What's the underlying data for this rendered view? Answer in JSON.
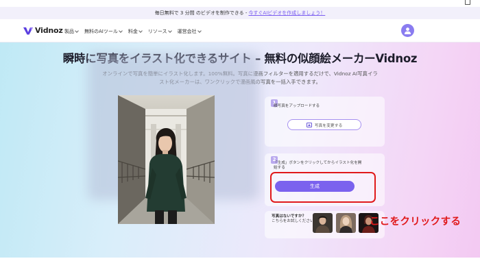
{
  "promo": {
    "text": "毎日無料で 3 分間 のビデオを制作できる - ",
    "link": "今すぐAIビデオを作成しましょう！"
  },
  "nav": {
    "brand": "Vidnoz",
    "menu": [
      "製品",
      "無料のAIツール",
      "料金",
      "リソース",
      "運営会社"
    ]
  },
  "hero": {
    "title": "瞬時に写真をイラスト化できるサイト – 無料の似顔絵メーカーVidnoz",
    "subtitle_line1": "オンラインで写真を簡単にイラスト化します。100%無料。写真に漫画フィルターを適用するだけで、Vidnoz AI写真イラ",
    "subtitle_line2": "スト化メーカーは、ワンクリックで漫画風の写真を一括入手できます。"
  },
  "steps": {
    "step1": {
      "number": "1",
      "text": "顔写真をアップロードする",
      "button": "写真を変更する"
    },
    "step2": {
      "number": "2",
      "text_line1": "「生成」ボタンをクリックしてからイラスト化を開",
      "text_line2": "始する",
      "button": "生成"
    },
    "try": {
      "title": "写真はないですか？",
      "text": "こちらをお試しください"
    }
  },
  "annotation": {
    "label": "ここをクリックする"
  },
  "colors": {
    "accent": "#7b62ee",
    "annotation": "#e0191a"
  }
}
